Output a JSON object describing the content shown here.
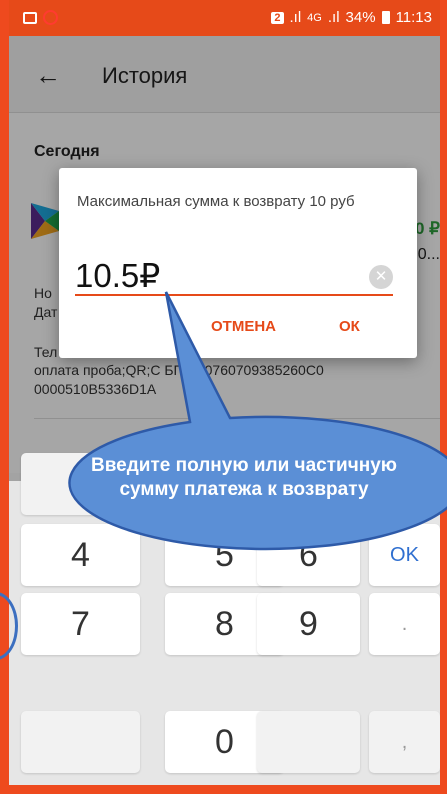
{
  "status_bar": {
    "sim": "2",
    "network": "4G",
    "battery": "34%",
    "time": "11:13"
  },
  "app_bar": {
    "back_icon": "arrow-left-icon",
    "title": "История"
  },
  "content": {
    "section": "Сегодня",
    "amount": "50 ₽",
    "sub": "0...",
    "line1": "Но",
    "line2": "Дат",
    "line3": "Тел",
    "line4": "оплата проба;QR;С     БП;A10760709385260C0",
    "line5": "0000510B5336D1A"
  },
  "dialog": {
    "message": "Максимальная сумма к возврату 10 руб",
    "input_value": "10.5₽",
    "clear_icon": "clear-icon",
    "cancel_label": "ОТМЕНА",
    "ok_label": "ОК"
  },
  "callout": {
    "text": "Введите полную или частичную сумму платежа к возврату"
  },
  "keypad": {
    "keys": [
      "4",
      "5",
      "6",
      "OK",
      "7",
      "8",
      "9",
      ".",
      "",
      "0",
      "",
      ","
    ]
  },
  "colors": {
    "accent": "#e64a19",
    "frame": "#ee4a1e",
    "callout_fill": "#5b8fd6",
    "callout_stroke": "#2e5aa8",
    "amount_green": "#2e9e3e"
  }
}
